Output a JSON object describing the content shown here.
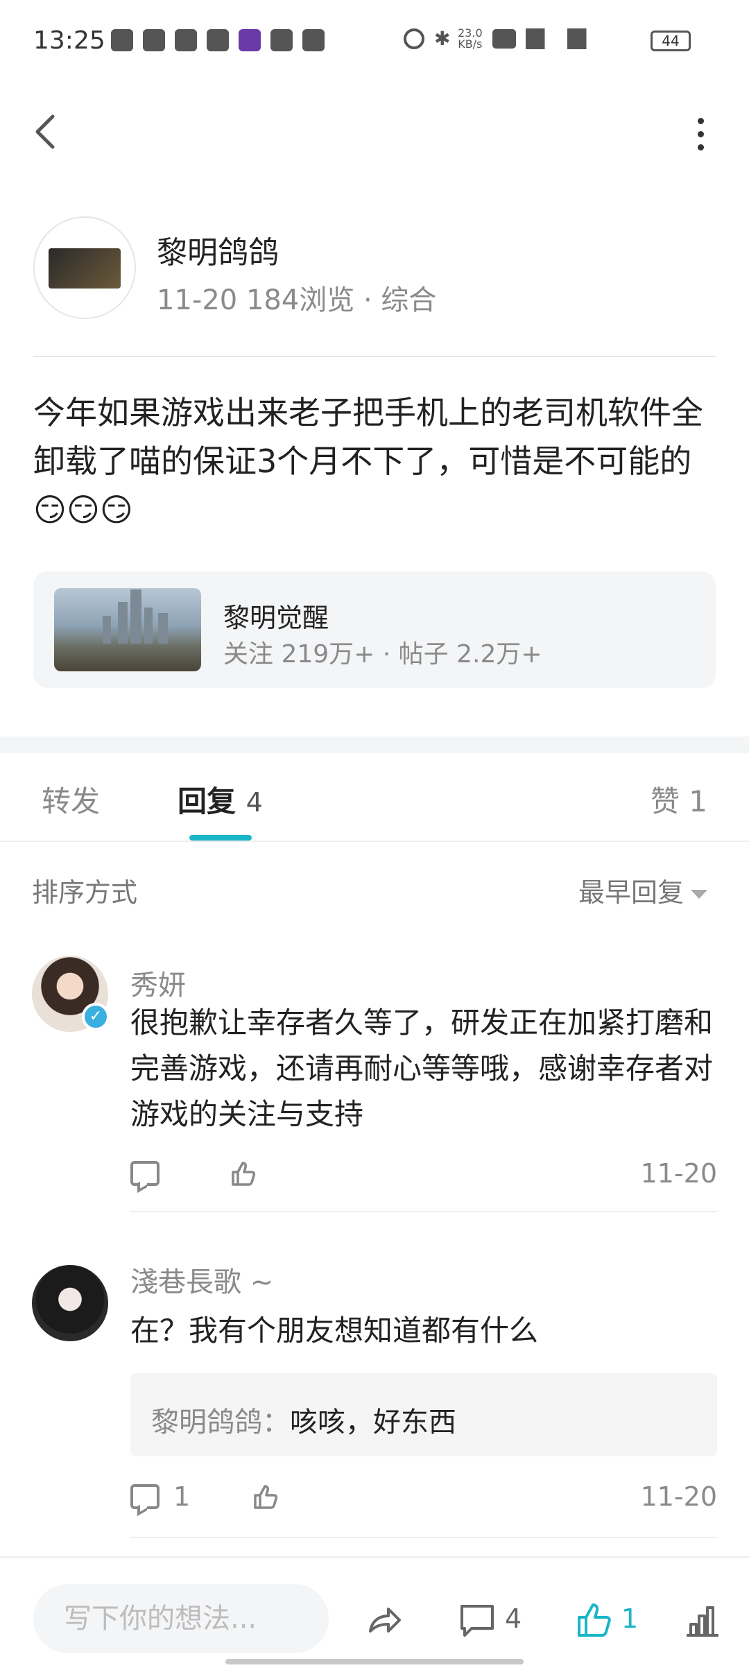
{
  "status_bar": {
    "time": "13:25",
    "network_speed": "23.0",
    "network_unit": "KB/s",
    "battery": "44"
  },
  "post": {
    "author": "黎明鸽鸽",
    "meta": "11-20 184浏览 · 综合",
    "text": "今年如果游戏出来老子把手机上的老司机软件全卸载了喵的保证3个月不下了，可惜是不可能的😏😏😏"
  },
  "game_card": {
    "title": "黎明觉醒",
    "stats": "关注 219万+ · 帖子 2.2万+"
  },
  "tabs": {
    "repost": "转发",
    "reply": "回复",
    "reply_count": "4",
    "like": "赞 1"
  },
  "sort": {
    "label": "排序方式",
    "value": "最早回复"
  },
  "comments": [
    {
      "name": "秀妍",
      "text": "很抱歉让幸存者久等了，研发正在加紧打磨和完善游戏，还请再耐心等等哦，感谢幸存者对游戏的关注与支持",
      "date": "11-20",
      "reply_count": ""
    },
    {
      "name": "淺巷長歌 ~",
      "text": "在？我有个朋友想知道都有什么",
      "date": "11-20",
      "reply_count": "1",
      "quote_name": "黎明鸽鸽：",
      "quote_text": "咳咳，好东西"
    }
  ],
  "bottom_bar": {
    "input_placeholder": "写下你的想法...",
    "comment_count": "4",
    "like_count": "1"
  },
  "colors": {
    "accent": "#1bb5c8",
    "text_primary": "#222222",
    "text_secondary": "#8a8a8a"
  }
}
